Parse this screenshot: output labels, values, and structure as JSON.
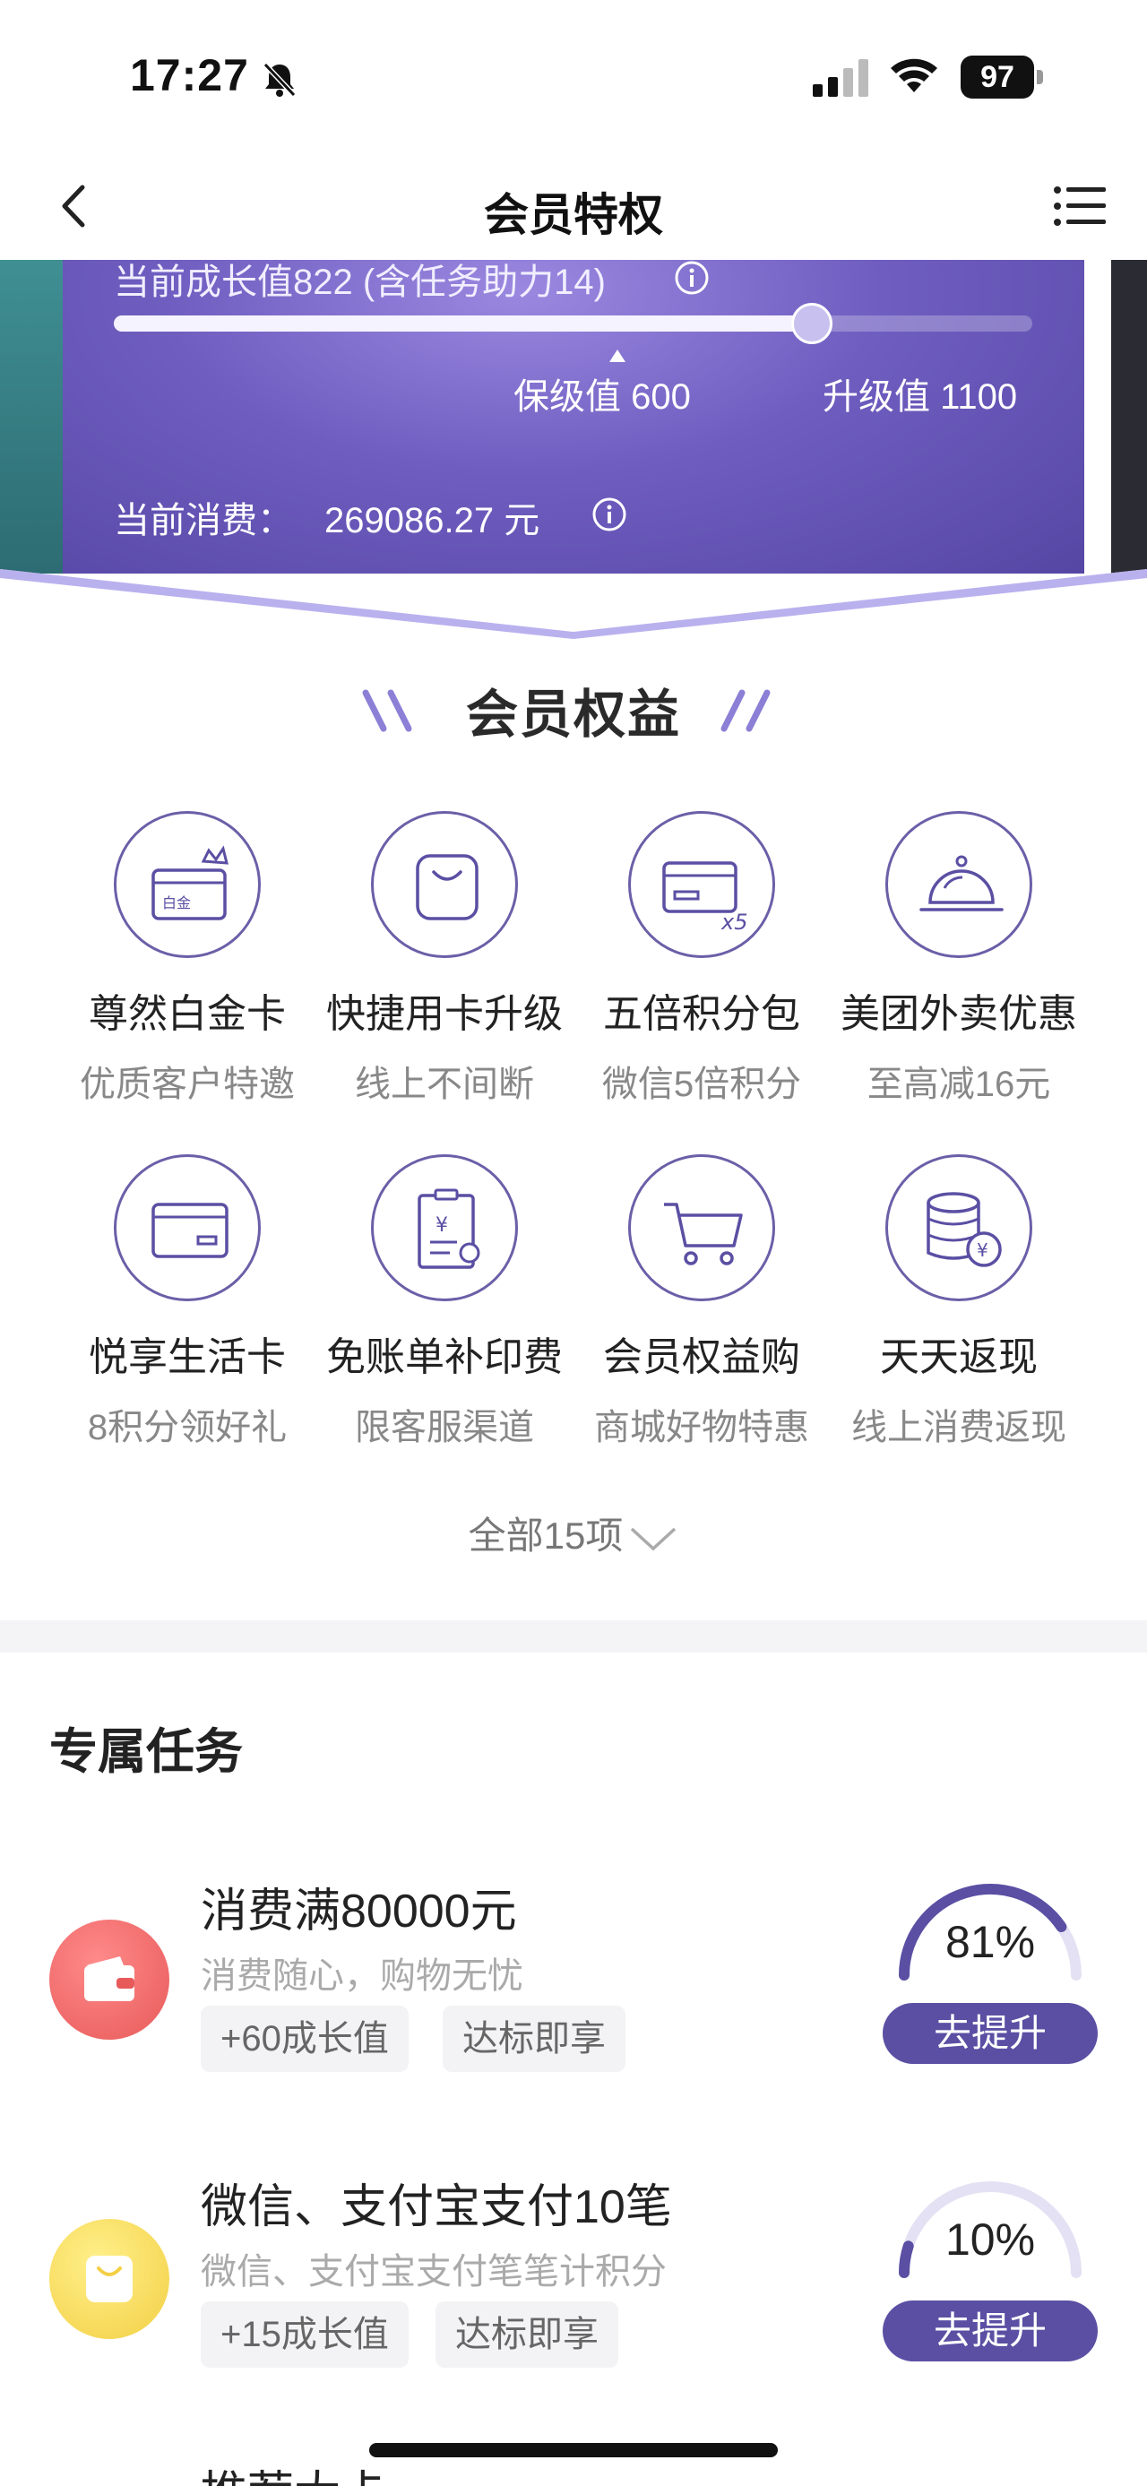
{
  "status_bar": {
    "time": "17:27",
    "battery": "97"
  },
  "nav": {
    "title": "会员特权"
  },
  "banner": {
    "growth_text": "当前成长值822 (含任务助力14)",
    "progress_fraction": 0.76,
    "keep_level": "保级值 600",
    "up_level": "升级值 1100",
    "spend_label": "当前消费：",
    "spend_value": "269086.27 元"
  },
  "benefits": {
    "title": "会员权益",
    "items": [
      {
        "name": "尊然白金卡",
        "desc": "优质客户特邀",
        "icon": "platinum-card-icon",
        "card_text": "白金"
      },
      {
        "name": "快捷用卡升级",
        "desc": "线上不间断",
        "icon": "bag-icon"
      },
      {
        "name": "五倍积分包",
        "desc": "微信5倍积分",
        "icon": "card-x5-icon",
        "badge": "x5"
      },
      {
        "name": "美团外卖优惠",
        "desc": "至高减16元",
        "icon": "food-cloche-icon"
      },
      {
        "name": "悦享生活卡",
        "desc": "8积分领好礼",
        "icon": "card-icon"
      },
      {
        "name": "免账单补印费",
        "desc": "限客服渠道",
        "icon": "bill-icon",
        "currency": "¥"
      },
      {
        "name": "会员权益购",
        "desc": "商城好物特惠",
        "icon": "cart-icon"
      },
      {
        "name": "天天返现",
        "desc": "线上消费返现",
        "icon": "coins-icon",
        "currency": "¥"
      }
    ],
    "all_items": "全部15项"
  },
  "tasks": {
    "title": "专属任务",
    "items": [
      {
        "title": "消费满80000元",
        "subtitle": "消费随心，购物无忧",
        "tags": [
          "+60成长值",
          "达标即享"
        ],
        "progress": "81%",
        "progress_value": 0.81,
        "button": "去提升",
        "icon": "wallet-icon",
        "icon_color": "#f07070"
      },
      {
        "title": "微信、支付宝支付10笔",
        "subtitle": "微信、支付宝支付笔笔计积分",
        "tags": [
          "+15成长值",
          "达标即享"
        ],
        "progress": "10%",
        "progress_value": 0.1,
        "button": "去提升",
        "icon": "shopping-bag-icon",
        "icon_color": "#f7d85a"
      }
    ],
    "partial_next_title": "推荐大卡"
  },
  "colors": {
    "accent": "#5a4fa3",
    "banner": "#6f5ec0"
  }
}
